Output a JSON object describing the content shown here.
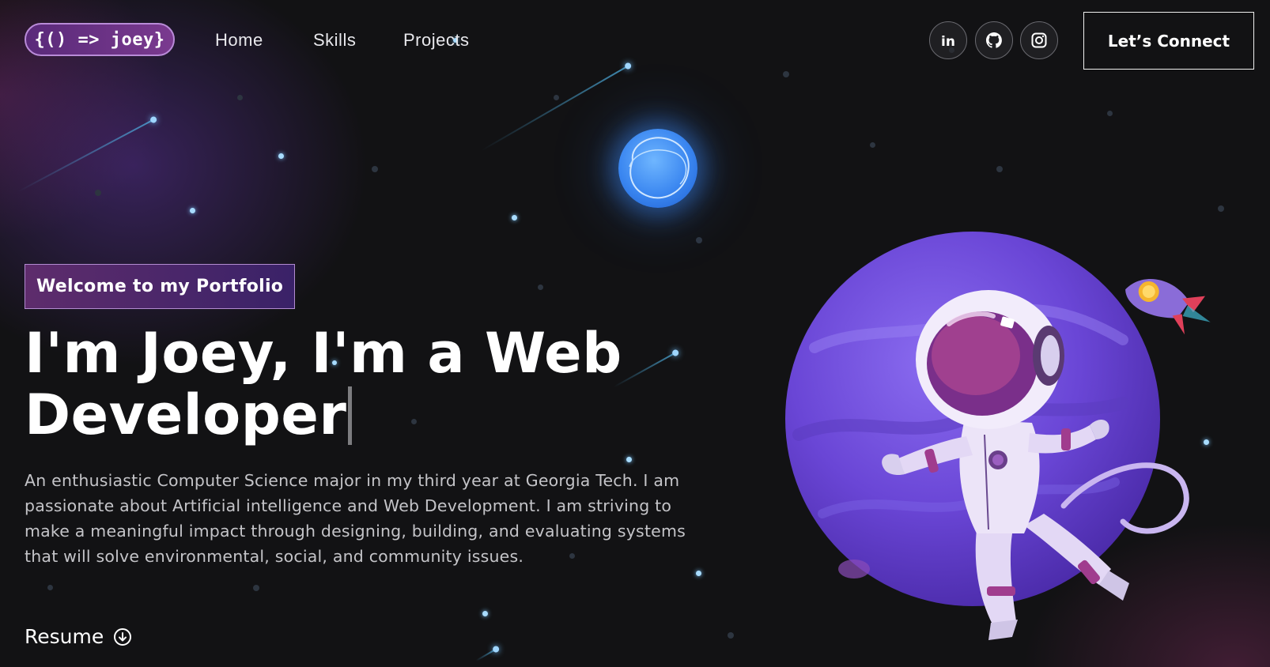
{
  "navbar": {
    "logo": "{() => joey}",
    "links": [
      {
        "label": "Home"
      },
      {
        "label": "Skills"
      },
      {
        "label": "Projects"
      }
    ],
    "social": [
      {
        "icon": "linkedin-icon",
        "label": "in"
      },
      {
        "icon": "github-icon"
      },
      {
        "icon": "instagram-icon"
      }
    ],
    "cta_label": "Let’s Connect"
  },
  "hero": {
    "tagline": "Welcome to my Portfolio",
    "headline": "I'm Joey, I'm a Web Developer",
    "description": "An enthusiastic Computer Science major in my third year at Georgia Tech. I am passionate about Artificial intelligence and Web Development. I am striving to make a meaningful impact through designing, building, and evaluating systems that will solve environmental, social, and community issues.",
    "resume_label": "Resume",
    "resume_icon": "download-circle-icon"
  },
  "illustration": {
    "items": [
      "glowing-blue-planet",
      "purple-planet",
      "astronaut",
      "rocket"
    ]
  },
  "colors": {
    "background": "#121214",
    "accent_purple": "#6a3fc7",
    "tagline_bg": "#5e2c6c",
    "text_muted": "#c4c4c8"
  }
}
